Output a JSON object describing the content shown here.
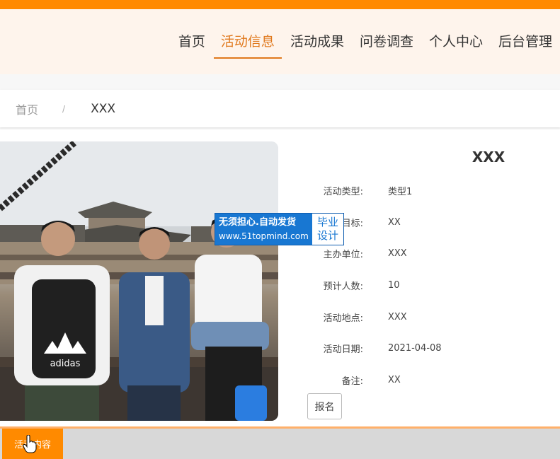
{
  "nav": {
    "items": [
      {
        "label": "首页",
        "active": false
      },
      {
        "label": "活动信息",
        "active": true
      },
      {
        "label": "活动成果",
        "active": false
      },
      {
        "label": "问卷调查",
        "active": false
      },
      {
        "label": "个人中心",
        "active": false
      },
      {
        "label": "后台管理",
        "active": false
      }
    ]
  },
  "breadcrumb": {
    "home": "首页",
    "separator": "/",
    "current": "XXX"
  },
  "detail": {
    "title": "XXX",
    "rows": [
      {
        "label": "活动类型:",
        "value": "类型1"
      },
      {
        "label": "目标:",
        "value": "XX"
      },
      {
        "label": "主办单位:",
        "value": "XXX"
      },
      {
        "label": "预计人数:",
        "value": "10"
      },
      {
        "label": "活动地点:",
        "value": "XXX"
      },
      {
        "label": "活动日期:",
        "value": "2021-04-08"
      },
      {
        "label": "备注:",
        "value": "XX"
      }
    ],
    "signup_label": "报名"
  },
  "watermark": {
    "line1": "无须担心.自动发货",
    "line2": "www.51topmind.com",
    "badge_top": "毕业",
    "badge_bottom": "设计"
  },
  "photo": {
    "shirt_logo": "adidas"
  },
  "tabs": {
    "active_label": "活动内容"
  },
  "colors": {
    "accent": "#ff8a00",
    "nav_active": "#e0781c",
    "header_bg": "#fef4ec"
  }
}
